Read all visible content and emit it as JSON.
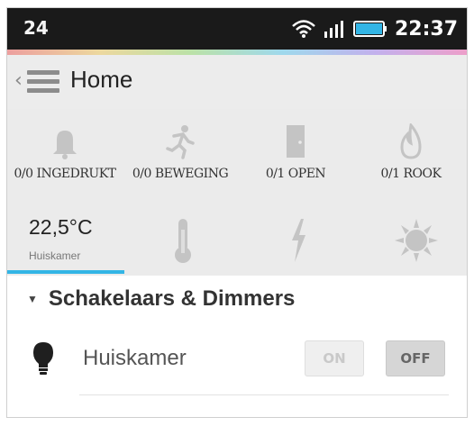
{
  "status_bar": {
    "notification_count": "24",
    "time": "22:37",
    "icons": [
      "wifi-icon",
      "signal-icon",
      "battery-icon"
    ]
  },
  "action_bar": {
    "title": "Home",
    "nav_icon": "hamburger-icon"
  },
  "sensors": [
    {
      "icon": "bell-icon",
      "label": "0/0 INGEDRUKT"
    },
    {
      "icon": "running-man-icon",
      "label": "0/0 BEWEGING"
    },
    {
      "icon": "door-icon",
      "label": "0/1 OPEN"
    },
    {
      "icon": "flame-icon",
      "label": "0/1 ROOK"
    }
  ],
  "climate": {
    "temperature": "22,5°C",
    "room": "Huiskamer",
    "icons": [
      "thermometer-icon",
      "lightning-icon",
      "sun-icon"
    ]
  },
  "section": {
    "title": "Schakelaars & Dimmers",
    "items": [
      {
        "icon": "lightbulb-icon",
        "label": "Huiskamer",
        "on_label": "ON",
        "off_label": "OFF",
        "state": "off"
      }
    ]
  },
  "colors": {
    "accent": "#33b5e5",
    "status_bar": "#1a1a1a",
    "icon_gray": "#c4c4c4"
  }
}
